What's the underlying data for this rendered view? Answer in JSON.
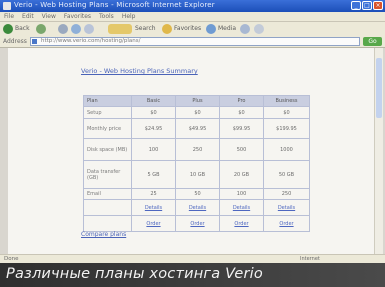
{
  "window": {
    "title": "Verio - Web Hosting Plans - Microsoft Internet Explorer",
    "minimize": "_",
    "maximize": "□",
    "close": "×"
  },
  "menu": [
    "File",
    "Edit",
    "View",
    "Favorites",
    "Tools",
    "Help"
  ],
  "toolbar": {
    "back_label": "Back",
    "search_label": "Search",
    "favorites_label": "Favorites",
    "media_label": "Media"
  },
  "address": {
    "label": "Address",
    "value": "http://www.verio.com/hosting/plans/",
    "go_label": "Go"
  },
  "page": {
    "heading": "Verio - Web Hosting Plans Summary",
    "bottom_link": "Compare plans"
  },
  "plans_table": {
    "headers": [
      "Plan",
      "Basic",
      "Plus",
      "Pro",
      "Business"
    ],
    "rows": [
      {
        "label": "Setup",
        "cells": [
          "$0",
          "$0",
          "$0",
          "$0"
        ]
      },
      {
        "label": "Monthly price",
        "cells": [
          "$24.95",
          "$49.95",
          "$99.95",
          "$199.95"
        ]
      },
      {
        "label": "Disk space (MB)",
        "cells": [
          "100",
          "250",
          "500",
          "1000"
        ]
      },
      {
        "label": "Data transfer (GB)",
        "cells": [
          "5 GB",
          "10 GB",
          "20 GB",
          "50 GB"
        ]
      },
      {
        "label": "Email",
        "cells": [
          "25",
          "50",
          "100",
          "250"
        ]
      }
    ],
    "link_rows": [
      [
        "Details",
        "Details",
        "Details",
        "Details"
      ],
      [
        "Order",
        "Order",
        "Order",
        "Order"
      ]
    ]
  },
  "status": {
    "text": "Done",
    "zone": "Internet"
  },
  "caption": "Различные планы хостинга Verio"
}
